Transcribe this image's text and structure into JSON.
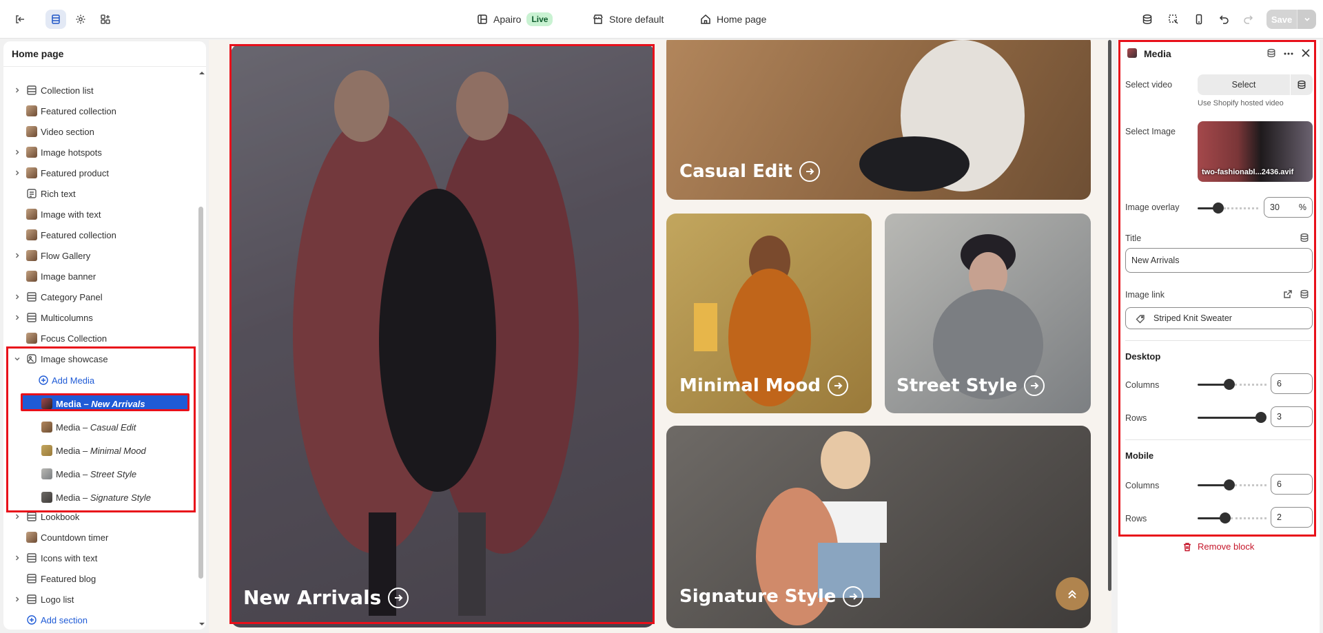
{
  "topbar": {
    "theme_name": "Apairo",
    "live_badge": "Live",
    "store": "Store default",
    "page": "Home page",
    "save_label": "Save"
  },
  "sidebar": {
    "title": "Home page",
    "items": [
      {
        "label": "Collection list",
        "icon": "collection-list-icon"
      },
      {
        "label": "Featured collection",
        "icon": "image-thumb"
      },
      {
        "label": "Video section",
        "icon": "image-thumb"
      },
      {
        "label": "Image hotspots",
        "icon": "image-thumb"
      },
      {
        "label": "Featured product",
        "icon": "image-thumb"
      },
      {
        "label": "Rich text",
        "icon": "text-icon"
      },
      {
        "label": "Image with text",
        "icon": "image-thumb"
      },
      {
        "label": "Featured collection",
        "icon": "image-thumb"
      },
      {
        "label": "Flow Gallery",
        "icon": "image-thumb"
      },
      {
        "label": "Image banner",
        "icon": "image-thumb"
      },
      {
        "label": "Category Panel",
        "icon": "list-icon"
      },
      {
        "label": "Multicolumns",
        "icon": "list-icon"
      },
      {
        "label": "Focus Collection",
        "icon": "image-thumb"
      },
      {
        "label": "Image showcase",
        "icon": "showcase-icon"
      }
    ],
    "add_media": "Add Media",
    "media_items": [
      {
        "prefix": "Media – ",
        "name": "New Arrivals"
      },
      {
        "prefix": "Media – ",
        "name": "Casual Edit"
      },
      {
        "prefix": "Media – ",
        "name": "Minimal Mood"
      },
      {
        "prefix": "Media – ",
        "name": "Street Style"
      },
      {
        "prefix": "Media – ",
        "name": "Signature Style"
      }
    ],
    "after_items": [
      {
        "label": "Lookbook"
      },
      {
        "label": "Countdown timer"
      },
      {
        "label": "Icons with text"
      },
      {
        "label": "Featured blog"
      },
      {
        "label": "Logo list"
      }
    ],
    "add_section": "Add section"
  },
  "canvas": {
    "tiles": [
      {
        "label": "New Arrivals"
      },
      {
        "label": "Casual Edit"
      },
      {
        "label": "Minimal Mood"
      },
      {
        "label": "Street Style"
      },
      {
        "label": "Signature Style"
      }
    ]
  },
  "panel": {
    "title": "Media",
    "select_video_label": "Select video",
    "select_button": "Select",
    "video_hint": "Use Shopify hosted video",
    "select_image_label": "Select Image",
    "image_filename": "two-fashionabl...2436.avif",
    "overlay_label": "Image overlay",
    "overlay_value": "30",
    "overlay_unit": "%",
    "overlay_fraction": 0.3,
    "title_label": "Title",
    "title_value": "New Arrivals",
    "link_label": "Image link",
    "link_value": "Striped Knit Sweater",
    "desktop_heading": "Desktop",
    "desktop_columns_label": "Columns",
    "desktop_columns": "6",
    "desktop_rows_label": "Rows",
    "desktop_rows": "3",
    "mobile_heading": "Mobile",
    "mobile_columns_label": "Columns",
    "mobile_columns": "6",
    "mobile_rows_label": "Rows",
    "mobile_rows": "2",
    "remove_block": "Remove block"
  },
  "colors": {
    "accent": "#1f5bd6",
    "highlight": "#e8101a",
    "danger": "#c5162a",
    "fab": "#b0844e"
  }
}
